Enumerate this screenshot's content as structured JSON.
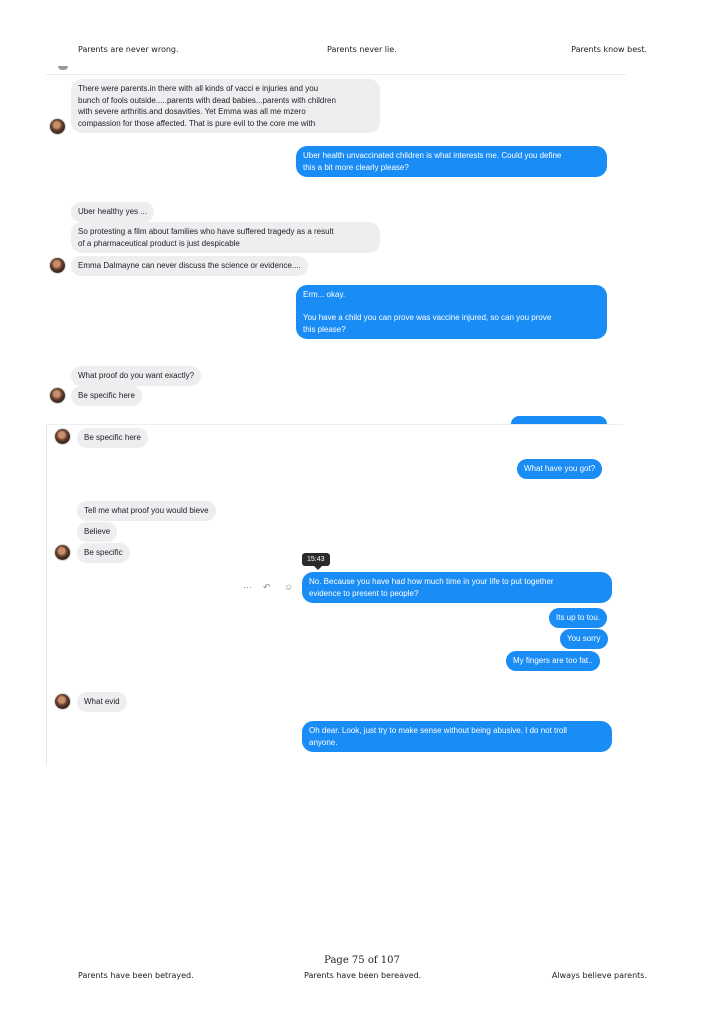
{
  "header": {
    "left": "Parents are never wrong.",
    "center": "Parents never lie.",
    "right": "Parents know best."
  },
  "footer": {
    "page_number": "Page 75 of 107",
    "left": "Parents have been betrayed.",
    "center": "Parents have been bereaved.",
    "right": "Always believe parents."
  },
  "chat1": {
    "m1": "There were parents.in there with all kinds of vacci e injuries and you\nbunch of fools outside.....parents with dead babies...parents with children\nwith severe arthritis.and dosavities.  Yet Emma was all me mzero\ncompassion for those affected. That is pure evil to the core me with",
    "m2": "Uber health unvaccinated children is what interests me. Could you define\nthis a bit more clearly please?",
    "m3": "Uber healthy yes ...",
    "m4": "So protesting a film about families who have suffered tragedy as a result\nof a pharmaceutical product is just despicable",
    "m5": "Emma Dalmayne can never discuss the science or evidence....",
    "m6": "Erm... okay.\n\nYou have a child you can prove was vaccine injured, so can you prove\nthis please?",
    "m7": "What proof do you want exactly?",
    "m8": "Be specific here"
  },
  "chat2": {
    "m1": "Be specific here",
    "m2": "What have you got?",
    "m3": "Tell me what proof you would bieve",
    "m4": "Believe",
    "m5": "Be specific",
    "timestamp": "15:43",
    "m6": "No. Because you have had how much time in your life to put together\nevidence to present to people?",
    "m7": "Its up to tou.",
    "m8": "You sorry",
    "m9": "My fingers are too fat..",
    "m10": "What evid",
    "m11": "Oh dear. Look, just try to make sense without being abusive. I do not troll\nanyone."
  },
  "icons": {
    "more": "more-icon",
    "reply": "reply-icon",
    "react": "emoji-icon"
  },
  "colors": {
    "outgoing": "#1a8cf5",
    "incoming": "#eeeef0"
  }
}
